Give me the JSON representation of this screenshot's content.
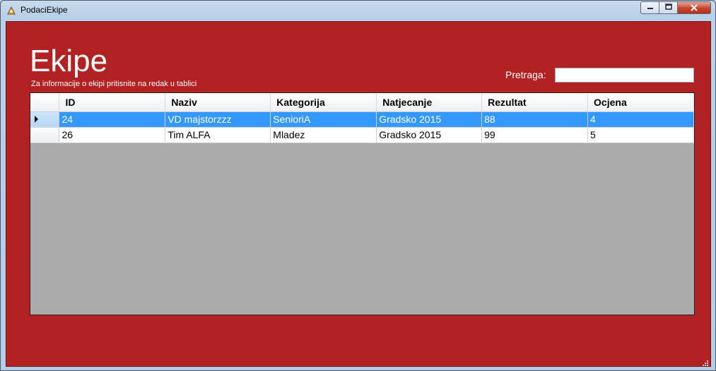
{
  "window": {
    "title": "PodaciEkipe"
  },
  "form": {
    "heading": "Ekipe",
    "subtitle": "Za informacije o ekipi pritisnite na redak u tablici",
    "search_label": "Pretraga:",
    "search_value": ""
  },
  "grid": {
    "columns": [
      "ID",
      "Naziv",
      "Kategorija",
      "Natjecanje",
      "Rezultat",
      "Ocjena"
    ],
    "rows": [
      {
        "cells": [
          "24",
          "VD majstorzzz",
          "SenioriA",
          "Gradsko 2015",
          "88",
          "4"
        ],
        "selected": true
      },
      {
        "cells": [
          "26",
          "Tim ALFA",
          "Mladez",
          "Gradsko 2015",
          "99",
          "5"
        ],
        "selected": false
      }
    ]
  },
  "colors": {
    "form_background": "#b22222",
    "selection": "#3399ff",
    "grid_background": "#ababab"
  },
  "icons": {
    "app": "app-icon",
    "minimize": "minimize-icon",
    "maximize": "maximize-icon",
    "close": "close-icon",
    "row_pointer": "row-pointer-icon",
    "resize": "resize-grip-icon"
  }
}
